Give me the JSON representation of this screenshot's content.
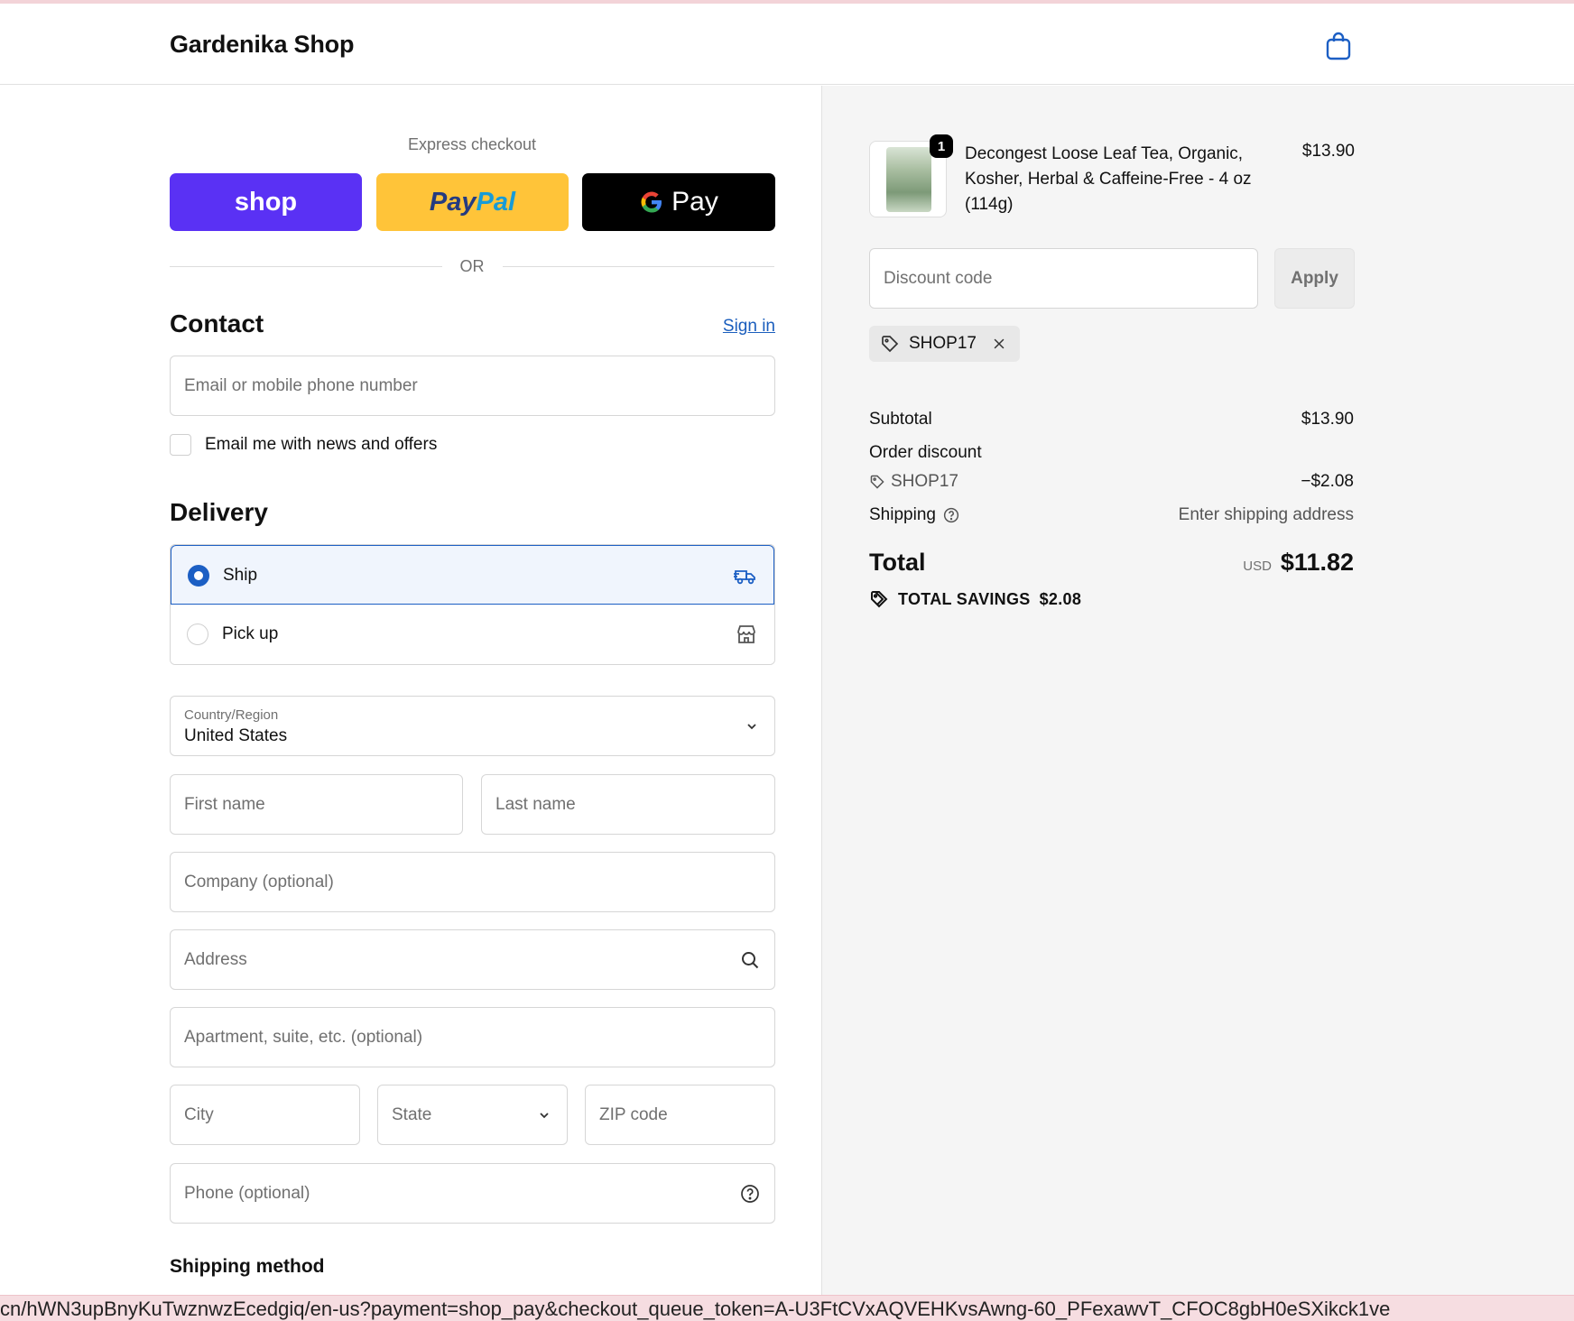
{
  "header": {
    "brand": "Gardenika Shop",
    "cart_icon": "shopping-bag-icon"
  },
  "express": {
    "title": "Express checkout",
    "shop_label": "shop",
    "paypal_part1": "Pay",
    "paypal_part2": "Pal",
    "gpay_label": "Pay",
    "or_label": "OR"
  },
  "contact": {
    "heading": "Contact",
    "sign_in": "Sign in",
    "email_placeholder": "Email or mobile phone number",
    "newsletter_label": "Email me with news and offers",
    "newsletter_checked": false
  },
  "delivery": {
    "heading": "Delivery",
    "options": [
      {
        "label": "Ship",
        "selected": true,
        "icon": "truck-icon"
      },
      {
        "label": "Pick up",
        "selected": false,
        "icon": "store-icon"
      }
    ],
    "country_label": "Country/Region",
    "country_value": "United States",
    "first_name": "First name",
    "last_name": "Last name",
    "company": "Company (optional)",
    "address": "Address",
    "apartment": "Apartment, suite, etc. (optional)",
    "city": "City",
    "state": "State",
    "zip": "ZIP code",
    "phone": "Phone (optional)",
    "shipping_method_heading": "Shipping method"
  },
  "summary": {
    "item": {
      "quantity": "1",
      "name": "Decongest Loose Leaf Tea, Organic, Kosher, Herbal & Caffeine-Free - 4 oz (114g)",
      "price": "$13.90"
    },
    "discount_placeholder": "Discount code",
    "apply_label": "Apply",
    "applied_code": "SHOP17",
    "subtotal_label": "Subtotal",
    "subtotal_value": "$13.90",
    "order_discount_label": "Order discount",
    "discount_code": "SHOP17",
    "discount_value": "−$2.08",
    "shipping_label": "Shipping",
    "shipping_value": "Enter shipping address",
    "total_label": "Total",
    "currency": "USD",
    "total_value": "$11.82",
    "savings_label": "TOTAL SAVINGS",
    "savings_value": "$2.08"
  },
  "browser": {
    "url_text": "cn/hWN3upBnyKuTwznwzEcedgiq/en-us?payment=shop_pay&checkout_queue_token=A-U3FtCVxAQVEHKvsAwng-60_PFexawvT_CFOC8gbH0eSXikck1ve"
  },
  "colors": {
    "accent": "#1c5fc4",
    "shop_pay": "#5a31f4",
    "paypal": "#ffc439",
    "summary_bg": "#f5f5f5"
  }
}
